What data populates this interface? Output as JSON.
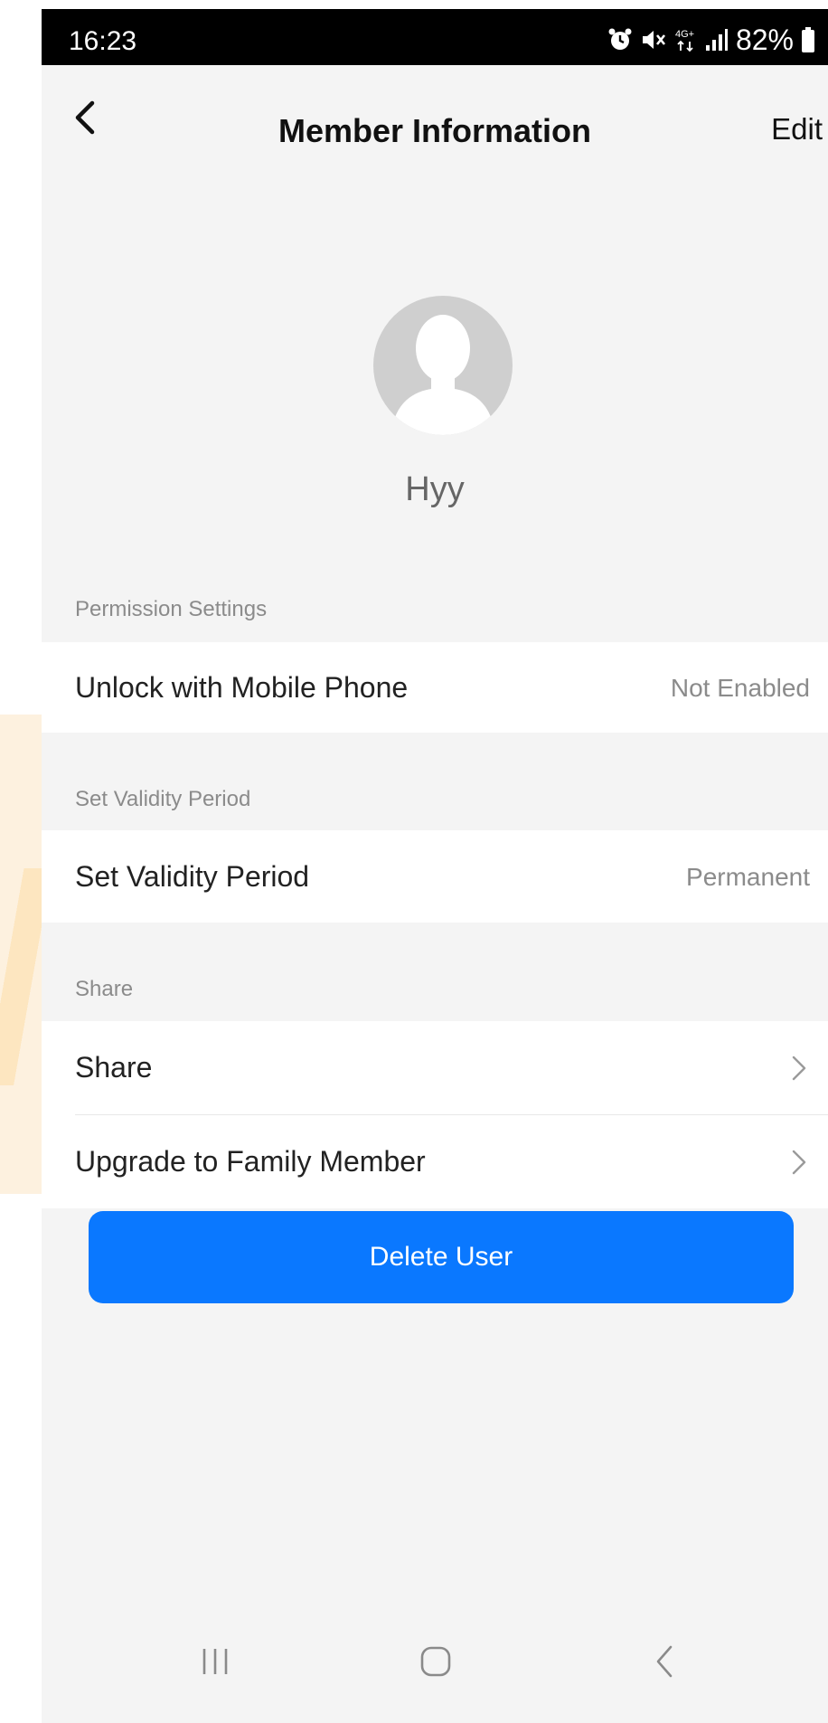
{
  "status_bar": {
    "time": "16:23",
    "battery_percent": "82%",
    "icons": [
      "alarm-icon",
      "mute-icon",
      "4g-icon",
      "signal-icon",
      "battery-icon"
    ],
    "network_label": "4G+"
  },
  "header": {
    "title": "Member Information",
    "edit_label": "Edit",
    "back_icon": "chevron-left-icon"
  },
  "profile": {
    "name": "Hyy",
    "avatar_icon": "default-avatar-icon"
  },
  "sections": {
    "permission": {
      "label": "Permission Settings",
      "unlock_label": "Unlock with Mobile Phone",
      "unlock_value": "Not Enabled"
    },
    "validity": {
      "label": "Set Validity Period",
      "row_label": "Set Validity Period",
      "row_value": "Permanent"
    },
    "share": {
      "label": "Share",
      "share_label": "Share",
      "upgrade_label": "Upgrade to Family Member"
    }
  },
  "actions": {
    "delete_label": "Delete User"
  },
  "colors": {
    "primary": "#0a78ff",
    "background": "#f4f4f4",
    "secondary_text": "#8b8b8b"
  }
}
